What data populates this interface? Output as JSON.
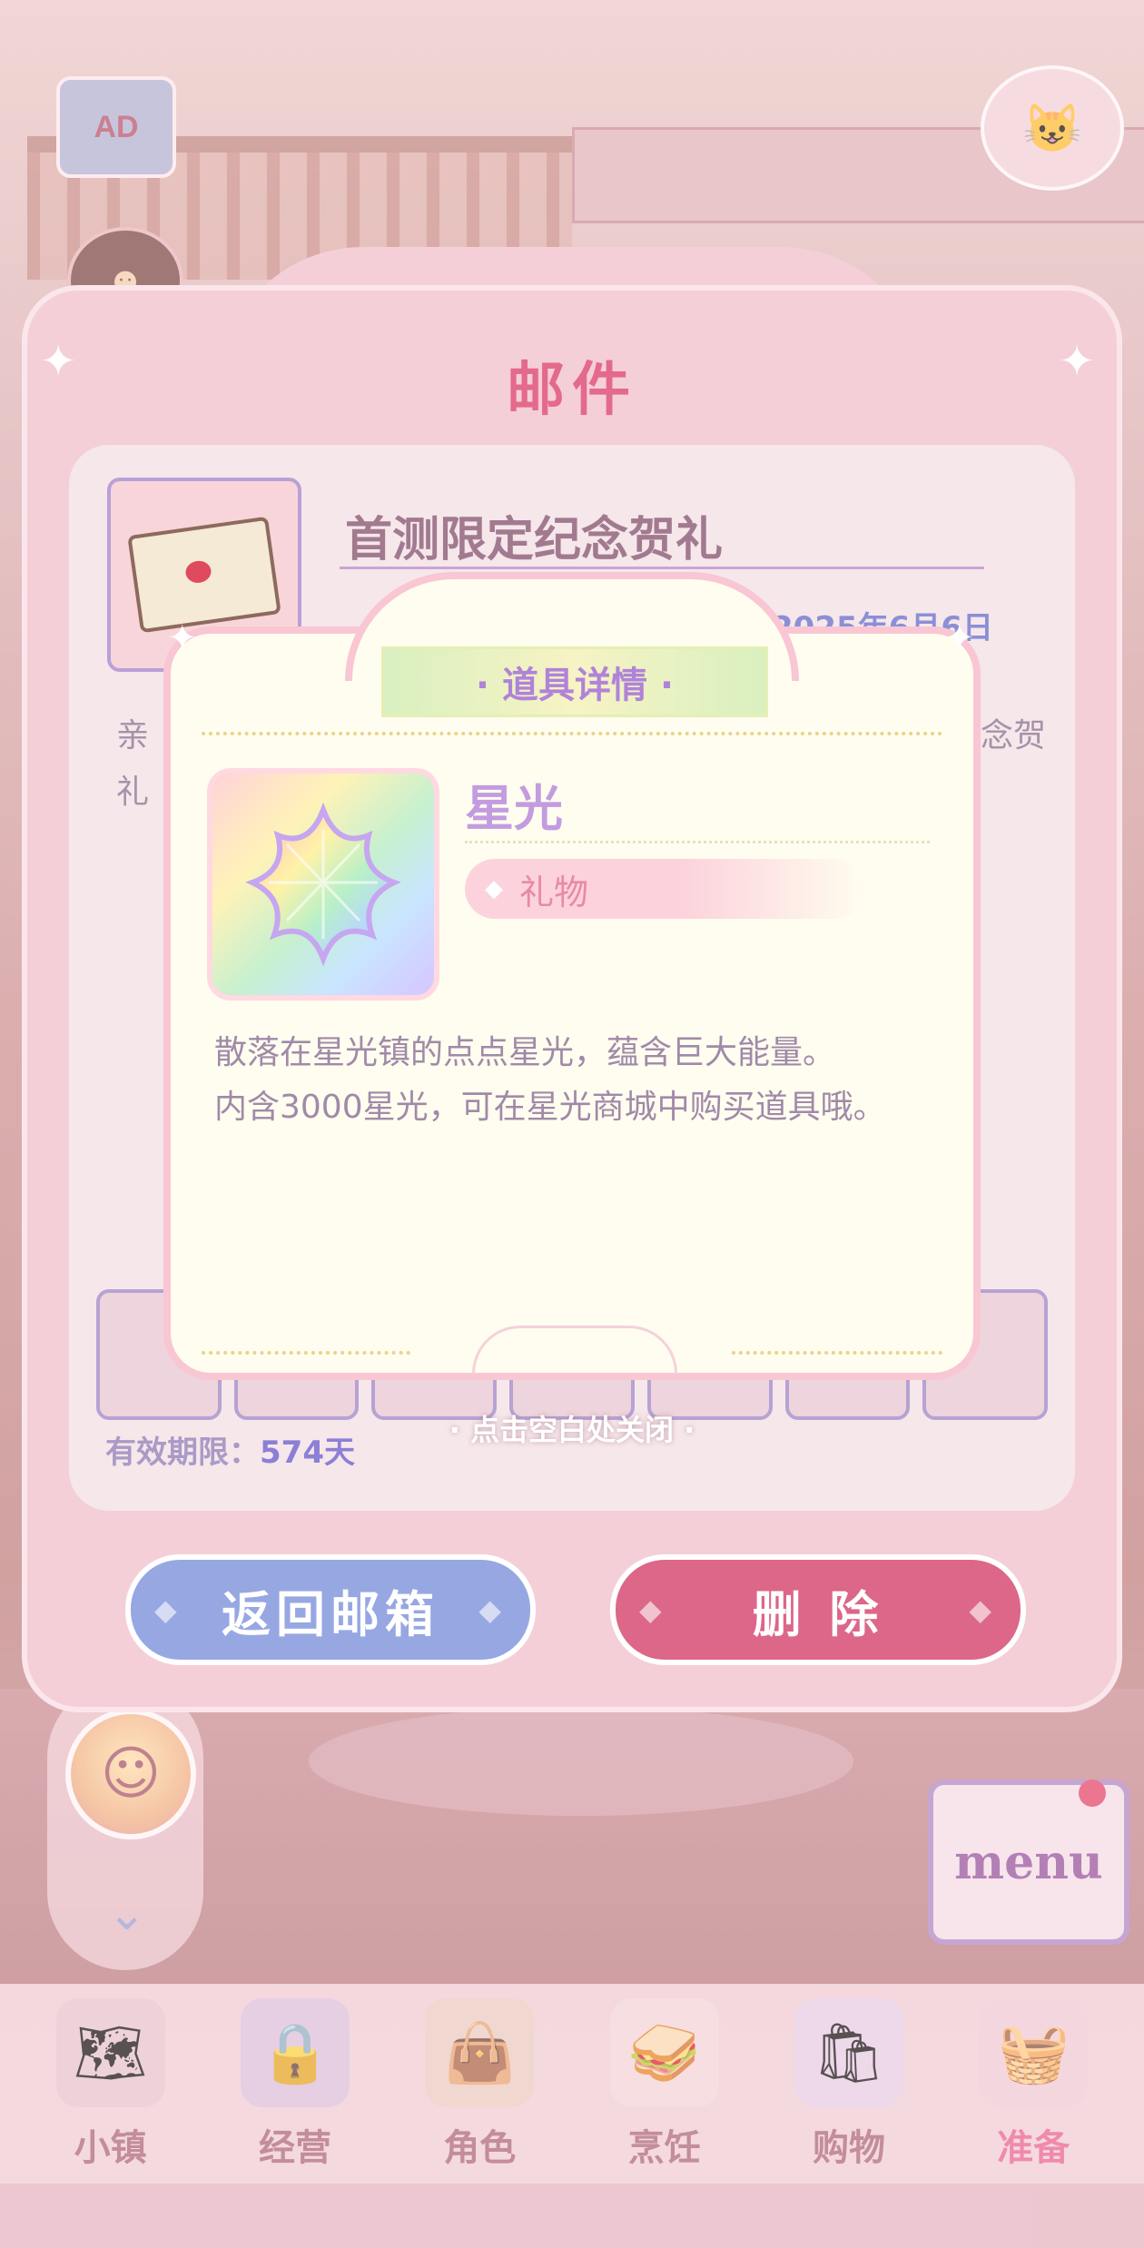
{
  "background": {
    "ad_label": "AD",
    "menu_label": "menu"
  },
  "bottom_nav": {
    "items": [
      {
        "label": "小镇",
        "icon": "map-icon"
      },
      {
        "label": "经营",
        "icon": "shop-bag-icon"
      },
      {
        "label": "角色",
        "icon": "character-icon"
      },
      {
        "label": "烹饪",
        "icon": "sandwich-icon"
      },
      {
        "label": "购物",
        "icon": "shopping-bag-icon"
      },
      {
        "label": "准备",
        "icon": "basket-icon"
      }
    ],
    "active_index": 5
  },
  "mail": {
    "title": "邮件",
    "subject": "首测限定纪念贺礼",
    "date": "2025年6月6日",
    "body_left": "亲",
    "body_left_2": "礼",
    "body_right": "念贺",
    "validity_label": "有效期限：",
    "validity_value": "574天",
    "close_hint": "· 点击空白处关闭 ·",
    "back_button": "返回邮箱",
    "delete_button": "删 除"
  },
  "item_detail": {
    "header": "· 道具详情 ·",
    "name": "星光",
    "tag": "礼物",
    "description_line1": "散落在星光镇的点点星光，蕴含巨大能量。",
    "description_line2": "内含3000星光，可在星光商城中购买道具哦。"
  },
  "colors": {
    "accent_pink": "#dc6788",
    "accent_blue": "#97a7e2",
    "item_name": "#c39ce0"
  }
}
